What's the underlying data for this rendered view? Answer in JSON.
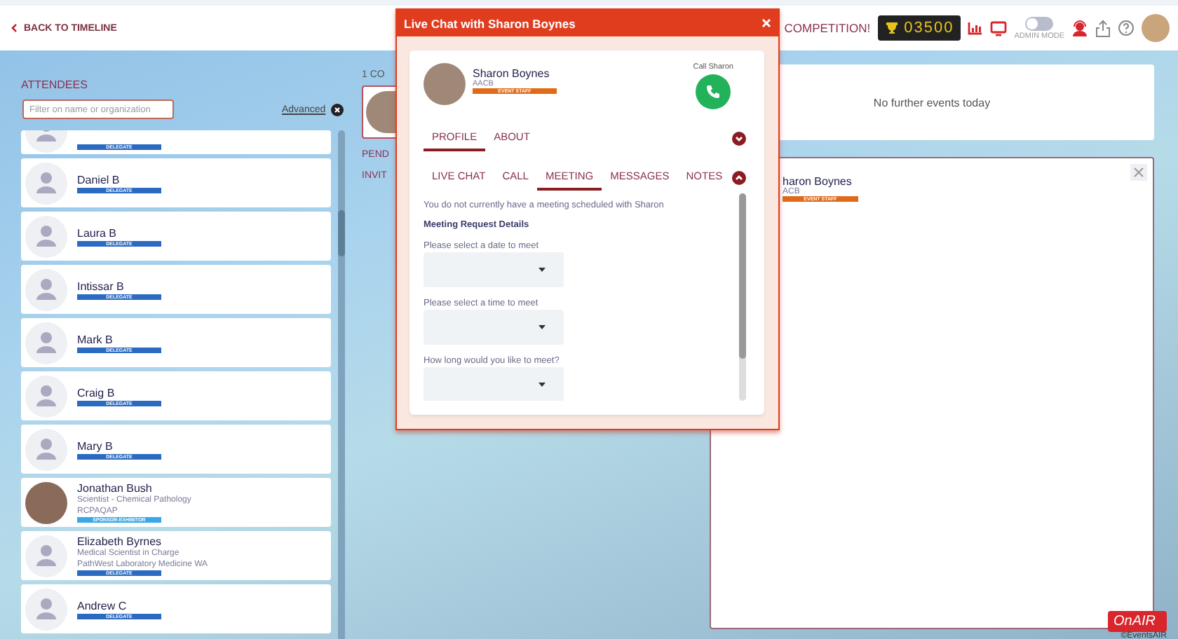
{
  "top_bar": {
    "back_link": "BACK TO TIMELINE",
    "competition": "COMPETITION!",
    "score": "03500",
    "admin_mode": {
      "label": "ADMIN MODE",
      "on": false
    }
  },
  "attendees": {
    "title": "ATTENDEES",
    "filter": {
      "placeholder": "Filter on name or organization"
    },
    "advanced_link": "Advanced",
    "items": [
      {
        "partial": true,
        "has_photo": false,
        "badge": "DELEGATE",
        "color": "#2a6ac0"
      },
      {
        "partial": false,
        "has_photo": false,
        "name": "Daniel B",
        "badge": "DELEGATE",
        "color": "#2a6ac0"
      },
      {
        "partial": false,
        "has_photo": false,
        "name": "Laura B",
        "badge": "DELEGATE",
        "color": "#2a6ac0"
      },
      {
        "partial": false,
        "has_photo": false,
        "name": "Intissar B",
        "badge": "DELEGATE",
        "color": "#2a6ac0"
      },
      {
        "partial": false,
        "has_photo": false,
        "name": "Mark B",
        "badge": "DELEGATE",
        "color": "#2a6ac0"
      },
      {
        "partial": false,
        "has_photo": false,
        "name": "Craig B",
        "badge": "DELEGATE",
        "color": "#2a6ac0"
      },
      {
        "partial": false,
        "has_photo": false,
        "name": "Mary B",
        "badge": "DELEGATE",
        "color": "#2a6ac0"
      },
      {
        "partial": false,
        "has_photo": true,
        "name": "Jonathan Bush",
        "details": [
          "Scientist - Chemical Pathology",
          "RCPAQAP"
        ],
        "badge": "SPONSOR-EXHIBITOR",
        "color": "#3aa8e8"
      },
      {
        "partial": false,
        "has_photo": false,
        "name": "Elizabeth Byrnes",
        "details": [
          "Medical Scientist in Charge",
          "PathWest Laboratory Medicine WA"
        ],
        "badge": "DELEGATE",
        "color": "#2a6ac0"
      },
      {
        "partial": false,
        "has_photo": false,
        "name": "Andrew C",
        "badge": "DELEGATE",
        "color": "#2a6ac0"
      }
    ]
  },
  "contacts": {
    "heading": "1 CO",
    "labels": [
      "PEND",
      "INVIT"
    ]
  },
  "chat_modal": {
    "title": "Live Chat with Sharon Boynes",
    "person": {
      "name": "Sharon Boynes",
      "organization": "AACB",
      "badge": "EVENT STAFF"
    },
    "call_label": "Call Sharon",
    "profile_tabs": {
      "expanded": false,
      "tabs": [
        {
          "label": "PROFILE",
          "selected": true
        },
        {
          "label": "ABOUT",
          "selected": false
        }
      ]
    },
    "section_tabs": {
      "expanded": true,
      "tabs": [
        {
          "label": "LIVE CHAT",
          "selected": false
        },
        {
          "label": "CALL",
          "selected": false
        },
        {
          "label": "MEETING",
          "selected": true
        },
        {
          "label": "MESSAGES",
          "selected": false
        },
        {
          "label": "NOTES",
          "selected": false
        }
      ]
    },
    "notice": "You do not currently have a meeting scheduled with Sharon",
    "section_title": "Meeting Request Details",
    "fields": [
      {
        "label": "Please select a date to meet"
      },
      {
        "label": "Please select a time to meet"
      },
      {
        "label": "How long would you like to meet?"
      }
    ]
  },
  "events_card": {
    "message": "No further events today"
  },
  "profile_card": {
    "name": "haron Boynes",
    "organization": "ACB",
    "badge": "EVENT STAFF"
  },
  "footer": {
    "logo": "OnAIR",
    "credit": "©EventsAIR"
  }
}
